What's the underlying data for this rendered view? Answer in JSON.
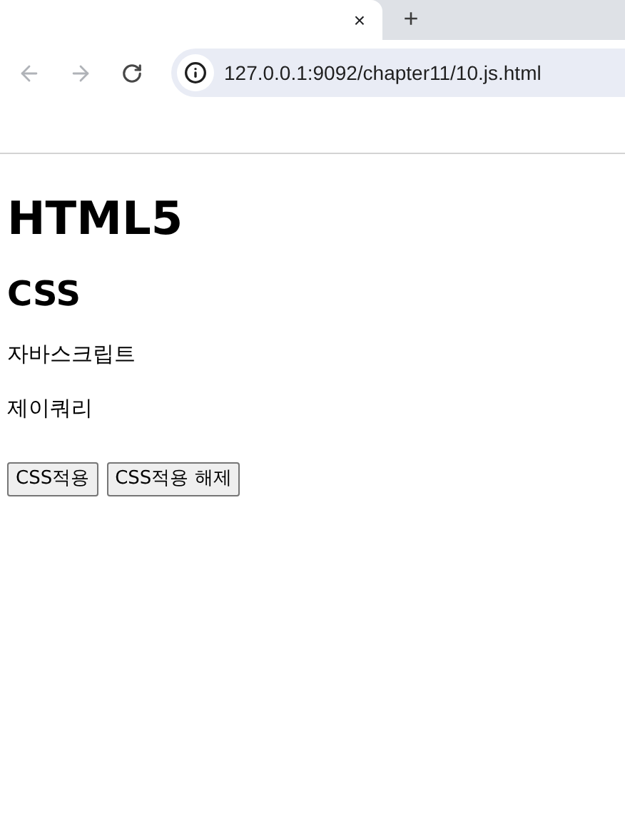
{
  "tabs": [
    {
      "close": "×",
      "selected": true
    }
  ],
  "new_tab": "+",
  "toolbar": {
    "back": {
      "disabled": true
    },
    "forward": {
      "disabled": true
    }
  },
  "address_bar": {
    "value": "127.0.0.1:9092/chapter11/10.js.html"
  },
  "page": {
    "heading_1": "HTML5",
    "heading_2": "CSS",
    "paragraphs": [
      "자바스크립트",
      "제이쿼리"
    ],
    "buttons": [
      "CSS적용",
      "CSS적용 해제"
    ]
  }
}
